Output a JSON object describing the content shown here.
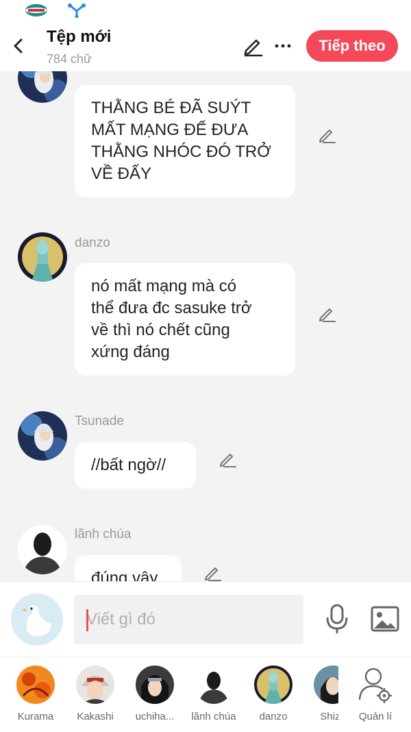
{
  "header": {
    "title": "Tệp mới",
    "word_count": "784 chữ",
    "next_label": "Tiếp theo"
  },
  "messages": [
    {
      "sender": "",
      "avatar": "tsunade-avatar",
      "text": "THẰNG BÉ ĐÃ SUÝT\nMẤT MẠNG ĐỂ ĐƯA\nTHẰNG NHÓC ĐÓ TRỞ\nVỀ ĐẤY"
    },
    {
      "sender": "danzo",
      "avatar": "danzo-avatar",
      "text": "nó mất mạng mà có\nthể đưa đc sasuke trở\nvề thì nó chết cũng\nxứng đáng"
    },
    {
      "sender": "Tsunade",
      "avatar": "tsunade-avatar",
      "text": "//bất ngờ//"
    },
    {
      "sender": "lãnh chúa",
      "avatar": "lord-avatar",
      "text": "đúng vậy"
    }
  ],
  "input": {
    "placeholder": "Viết gì đó"
  },
  "characters": [
    {
      "name": "Kurama"
    },
    {
      "name": "Kakashi"
    },
    {
      "name": "uchiha..."
    },
    {
      "name": "lãnh chúa"
    },
    {
      "name": "danzo"
    },
    {
      "name": "Shizu"
    }
  ],
  "manage_label": "Quản lí",
  "colors": {
    "accent": "#f5495a",
    "background": "#f3f3f3",
    "bubble": "#ffffff",
    "muted_text": "#999999"
  }
}
